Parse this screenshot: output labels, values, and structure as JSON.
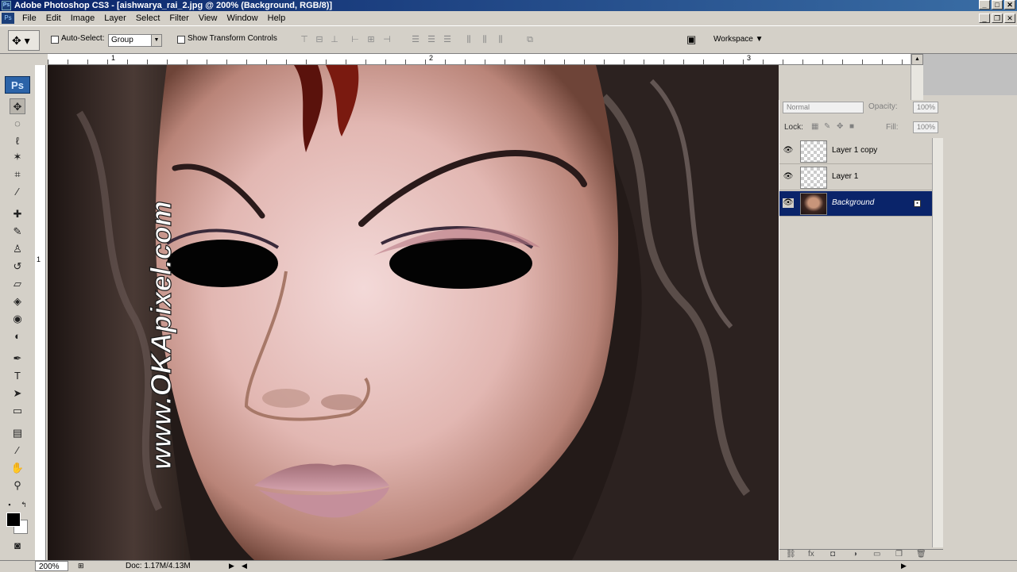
{
  "window": {
    "title": "Adobe Photoshop CS3 - [aishwarya_rai_2.jpg @ 200% (Background, RGB/8)]",
    "controls": [
      "_",
      "□",
      "✕"
    ]
  },
  "menu": {
    "items": [
      "File",
      "Edit",
      "Image",
      "Layer",
      "Select",
      "Filter",
      "View",
      "Window",
      "Help"
    ],
    "doc_controls": [
      "_",
      "❐",
      "✕"
    ]
  },
  "options": {
    "auto_select_label": "Auto-Select:",
    "auto_select_value": "Group",
    "show_transform_label": "Show Transform Controls",
    "workspace_label": "Workspace ▼"
  },
  "ruler": {
    "h_labels": [
      "1",
      "2",
      "3"
    ],
    "v_labels": [
      "1"
    ]
  },
  "toolbox": {
    "logo": "Ps"
  },
  "canvas": {
    "watermark": "www.OKApixel.com"
  },
  "layers_panel": {
    "blend_mode": "Normal",
    "opacity_label": "Opacity:",
    "opacity_value": "100%",
    "lock_label": "Lock:",
    "fill_label": "Fill:",
    "fill_value": "100%",
    "layers": [
      {
        "name": "Layer 1 copy",
        "visible": true,
        "selected": false
      },
      {
        "name": "Layer 1",
        "visible": true,
        "selected": false
      },
      {
        "name": "Background",
        "visible": true,
        "selected": true
      }
    ]
  },
  "status": {
    "zoom": "200%",
    "doc_info": "Doc: 1.17M/4.13M"
  },
  "colors": {
    "title_bar": "#0a246a",
    "selection": "#0a246a",
    "chrome": "#d4d0c8"
  }
}
